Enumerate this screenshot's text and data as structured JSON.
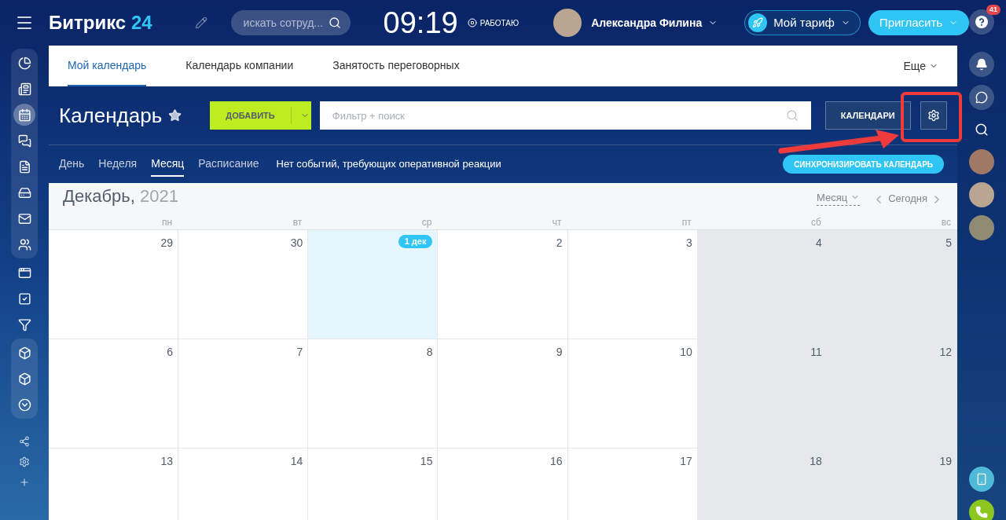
{
  "topbar": {
    "logo_name": "Битрикс",
    "logo_num": "24",
    "search_placeholder": "искать сотруд...",
    "time": "09:19",
    "work_status": "РАБОТАЮ",
    "user_name": "Александра Филина",
    "tariff": "Мой тариф",
    "invite": "Пригласить",
    "help_badge": "41"
  },
  "left_nav": [
    {
      "selected": false
    },
    {
      "selected": false
    },
    {
      "selected": true
    },
    {
      "selected": false
    },
    {
      "selected": false
    },
    {
      "selected": false
    },
    {
      "selected": false
    },
    {
      "selected": false
    },
    {
      "selected": false
    },
    {
      "selected": false
    },
    {
      "selected": false
    },
    {
      "selected": false
    },
    {
      "selected": false
    },
    {
      "selected": false
    }
  ],
  "tabs": [
    {
      "label": "Мой календарь",
      "selected": true
    },
    {
      "label": "Календарь компании",
      "selected": false
    },
    {
      "label": "Занятость переговорных",
      "selected": false
    }
  ],
  "tabs_more": "Еще",
  "header": {
    "title": "Календарь",
    "add_button": "ДОБАВИТЬ",
    "filter_placeholder": "Фильтр + поиск",
    "calendars_button": "КАЛЕНДАРИ"
  },
  "views": [
    {
      "label": "День",
      "selected": false
    },
    {
      "label": "Неделя",
      "selected": false
    },
    {
      "label": "Месяц",
      "selected": true
    },
    {
      "label": "Расписание",
      "selected": false
    }
  ],
  "notice": "Нет событий, требующих оперативной реакции",
  "sync_button": "СИНХРОНИЗИРОВАТЬ КАЛЕНДАРЬ",
  "calendar": {
    "month": "Декабрь,",
    "year": "2021",
    "view_select": "Месяц",
    "today_button": "Сегодня",
    "columns": [
      {
        "label": "пн",
        "weekend": false
      },
      {
        "label": "вт",
        "weekend": false
      },
      {
        "label": "ср",
        "weekend": false
      },
      {
        "label": "чт",
        "weekend": false
      },
      {
        "label": "пт",
        "weekend": false
      },
      {
        "label": "сб",
        "weekend": true
      },
      {
        "label": "вс",
        "weekend": true
      }
    ],
    "weeks": [
      [
        {
          "day": "29",
          "today": false
        },
        {
          "day": "30",
          "today": false
        },
        {
          "day": "1 дек",
          "today": true
        },
        {
          "day": "2",
          "today": false
        },
        {
          "day": "3",
          "today": false
        },
        {
          "day": "4",
          "today": false
        },
        {
          "day": "5",
          "today": false
        }
      ],
      [
        {
          "day": "6",
          "today": false
        },
        {
          "day": "7",
          "today": false
        },
        {
          "day": "8",
          "today": false
        },
        {
          "day": "9",
          "today": false
        },
        {
          "day": "10",
          "today": false
        },
        {
          "day": "11",
          "today": false
        },
        {
          "day": "12",
          "today": false
        }
      ],
      [
        {
          "day": "13",
          "today": false
        },
        {
          "day": "14",
          "today": false
        },
        {
          "day": "15",
          "today": false
        },
        {
          "day": "16",
          "today": false
        },
        {
          "day": "17",
          "today": false
        },
        {
          "day": "18",
          "today": false
        },
        {
          "day": "19",
          "today": false
        }
      ]
    ]
  }
}
